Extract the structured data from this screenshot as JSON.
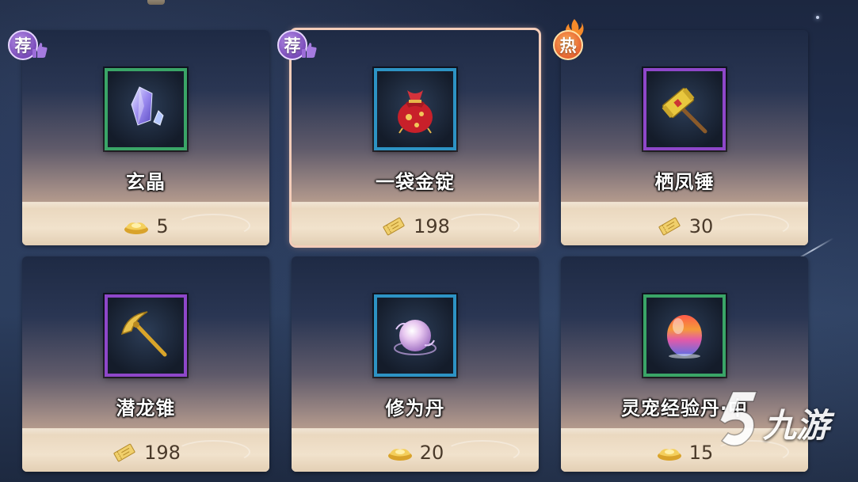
{
  "items": [
    {
      "name": "玄晶",
      "price": "5",
      "currency_icon": "gold-ingot-icon",
      "item_icon": "crystal-icon",
      "frame_color": "#3aa567",
      "badge": {
        "type": "recommend",
        "text": "荐"
      }
    },
    {
      "name": "一袋金锭",
      "price": "198",
      "currency_icon": "voucher-icon",
      "item_icon": "money-bag-icon",
      "frame_color": "#2d93c4",
      "badge": {
        "type": "recommend",
        "text": "荐"
      },
      "selected": true
    },
    {
      "name": "栖凤锤",
      "price": "30",
      "currency_icon": "voucher-icon",
      "item_icon": "hammer-icon",
      "frame_color": "#8e47c9",
      "badge": {
        "type": "hot",
        "text": "热"
      }
    },
    {
      "name": "潜龙锥",
      "price": "198",
      "currency_icon": "voucher-icon",
      "item_icon": "pickaxe-icon",
      "frame_color": "#8e47c9"
    },
    {
      "name": "修为丹",
      "price": "20",
      "currency_icon": "gold-ingot-icon",
      "item_icon": "pearl-pill-icon",
      "frame_color": "#2d93c4"
    },
    {
      "name": "灵宠经验丹·中",
      "price": "15",
      "currency_icon": "gold-ingot-icon",
      "item_icon": "rainbow-egg-icon",
      "frame_color": "#3aa567"
    }
  ],
  "watermark": {
    "text": "九游"
  }
}
